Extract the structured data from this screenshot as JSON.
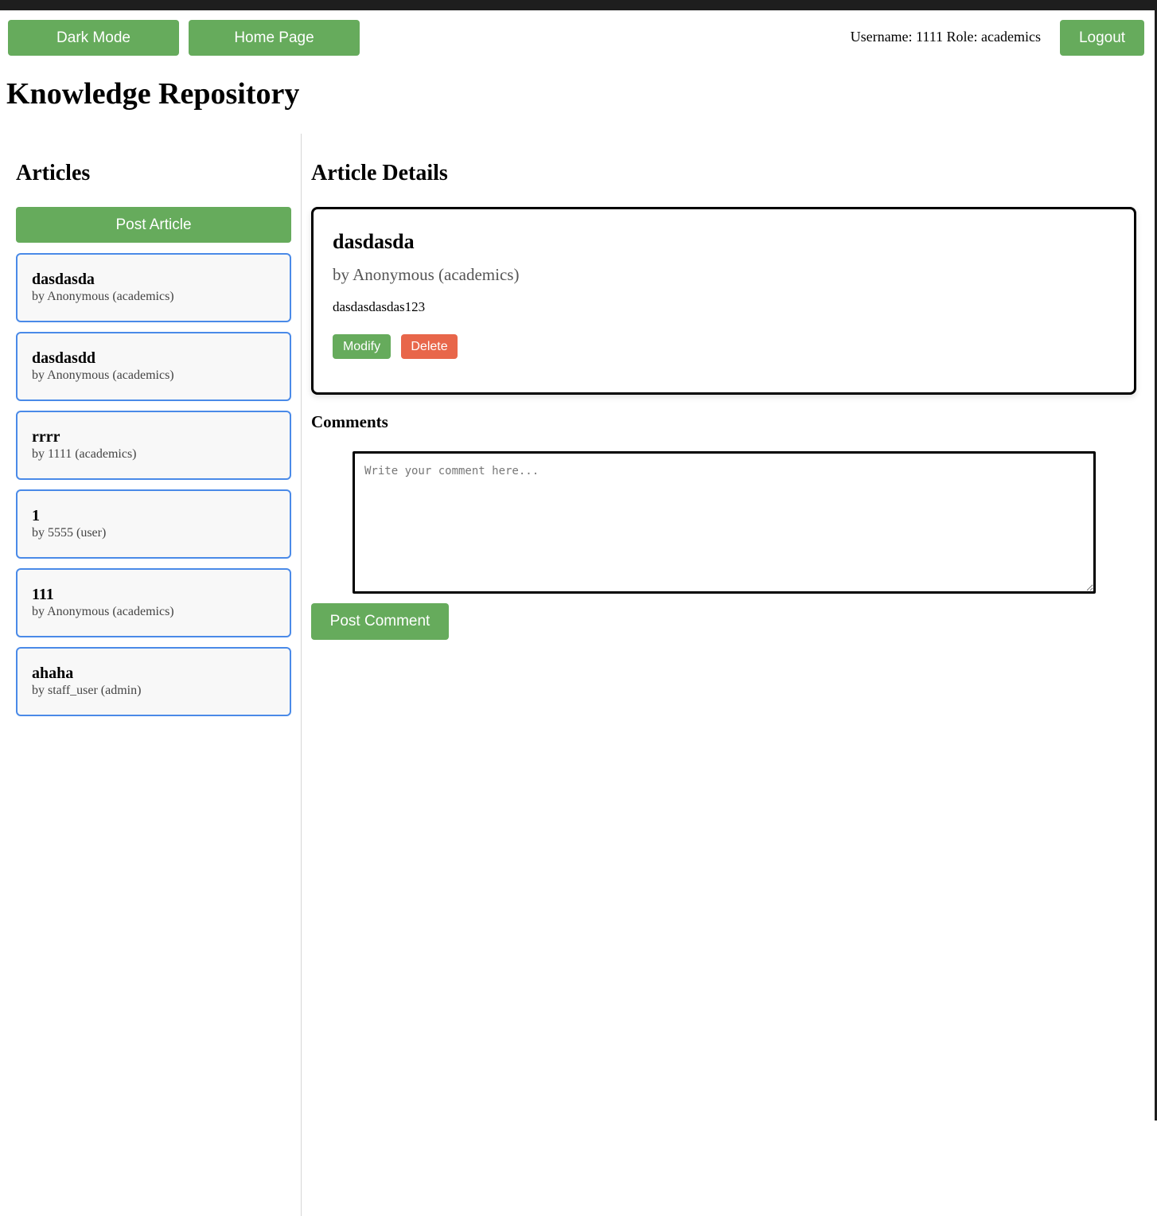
{
  "header": {
    "dark_mode_label": "Dark Mode",
    "home_page_label": "Home Page",
    "username_text": "Username: 1111",
    "role_text": "Role: academics",
    "logout_label": "Logout"
  },
  "app_title": "Knowledge Repository",
  "articles_panel": {
    "heading": "Articles",
    "post_article_label": "Post Article",
    "items": [
      {
        "title": "dasdasda",
        "author": "by Anonymous (academics)"
      },
      {
        "title": "dasdasdd",
        "author": "by Anonymous (academics)"
      },
      {
        "title": "rrrr",
        "author": "by 1111 (academics)"
      },
      {
        "title": "1",
        "author": "by 5555 (user)"
      },
      {
        "title": "111",
        "author": "by Anonymous (academics)"
      },
      {
        "title": "ahaha",
        "author": "by staff_user (admin)"
      }
    ]
  },
  "details_panel": {
    "heading": "Article Details",
    "article": {
      "title": "dasdasda",
      "author": "by Anonymous (academics)",
      "content": "dasdasdasdas123"
    },
    "modify_label": "Modify",
    "delete_label": "Delete"
  },
  "comments": {
    "heading": "Comments",
    "placeholder": "Write your comment here...",
    "value": "",
    "post_comment_label": "Post Comment"
  },
  "colors": {
    "primary_green": "#66ab5c",
    "delete_red": "#e8664a",
    "card_border_blue": "#4a8ae8"
  }
}
